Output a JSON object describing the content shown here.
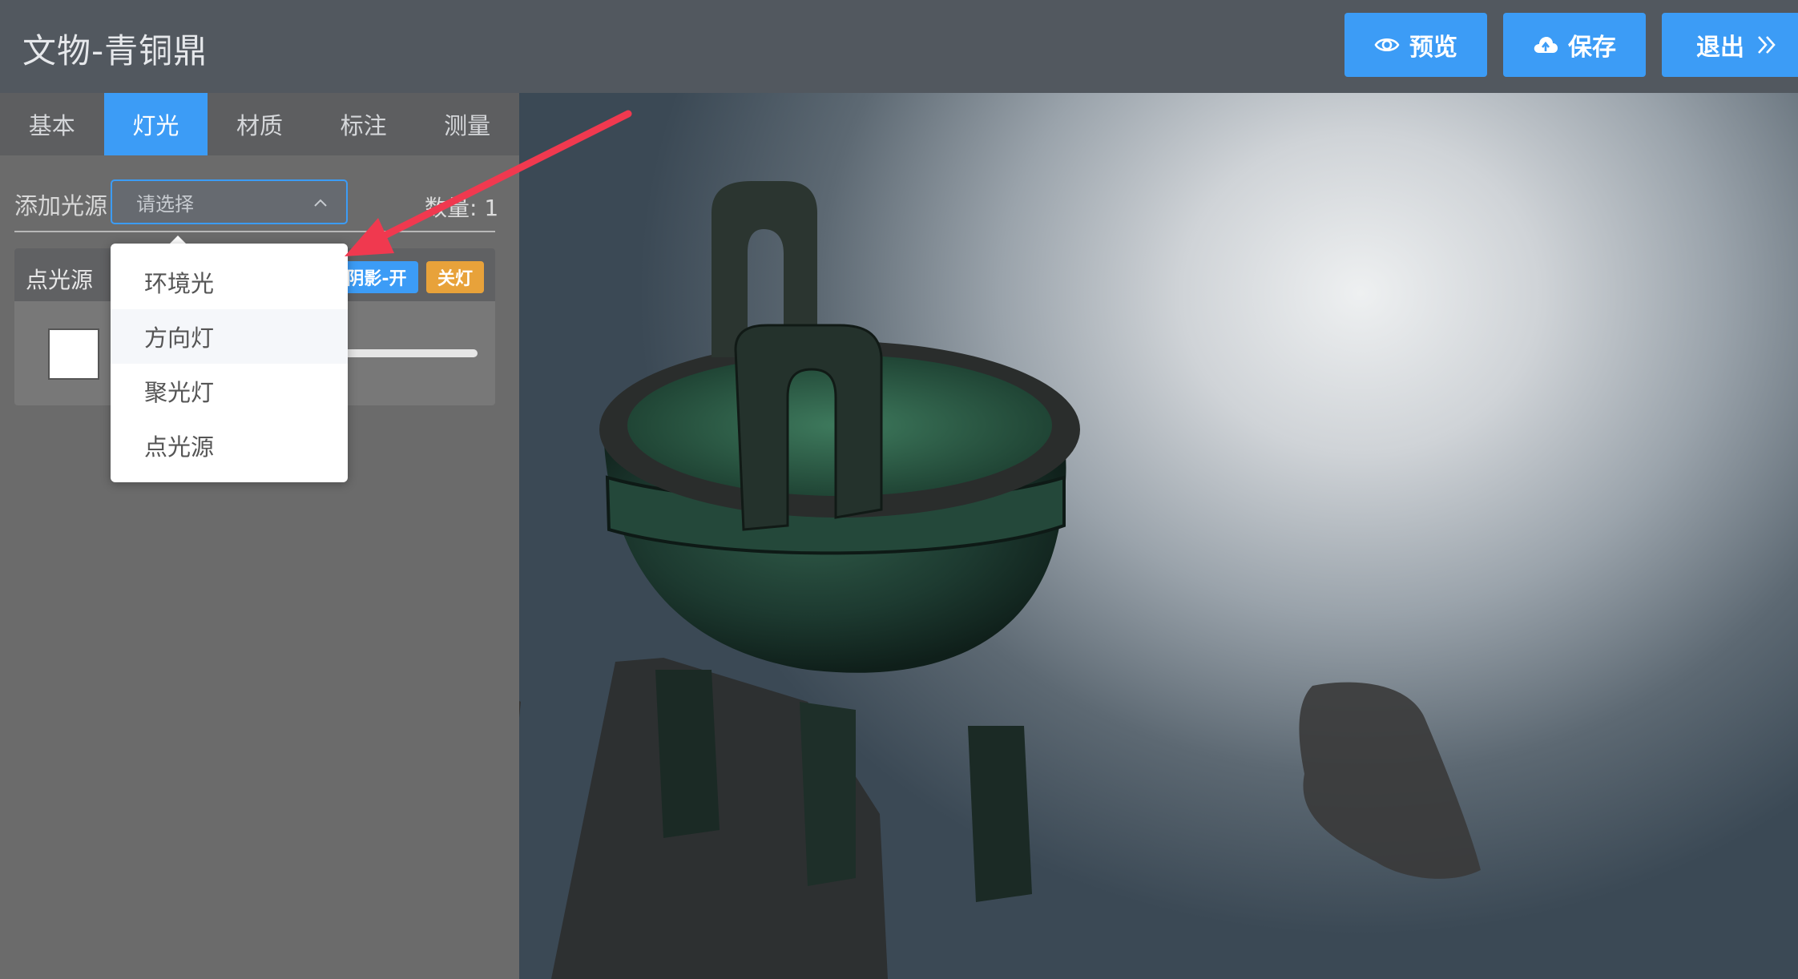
{
  "header": {
    "title": "文物-青铜鼎",
    "buttons": {
      "preview": "预览",
      "save": "保存",
      "exit": "退出"
    }
  },
  "sidebar": {
    "tabs": [
      {
        "label": "基本"
      },
      {
        "label": "灯光",
        "active": true
      },
      {
        "label": "材质"
      },
      {
        "label": "标注"
      },
      {
        "label": "测量"
      }
    ],
    "add_light": {
      "label": "添加光源",
      "placeholder": "请选择",
      "count_label": "数量: 1"
    },
    "light_card": {
      "name": "点光源",
      "shadow_badge": "阴影-开",
      "toggle_badge": "关灯",
      "color": "#ffffff"
    },
    "dropdown_options": [
      {
        "label": "环境光"
      },
      {
        "label": "方向灯"
      },
      {
        "label": "聚光灯"
      },
      {
        "label": "点光源"
      }
    ]
  },
  "colors": {
    "accent": "#3c9cf6",
    "warning": "#e8a23a",
    "annotation_arrow": "#f0394f"
  },
  "icons": {
    "preview": "eye-icon",
    "save": "cloud-upload-icon",
    "exit": "double-chevron-right-icon",
    "select": "chevron-up-icon"
  }
}
